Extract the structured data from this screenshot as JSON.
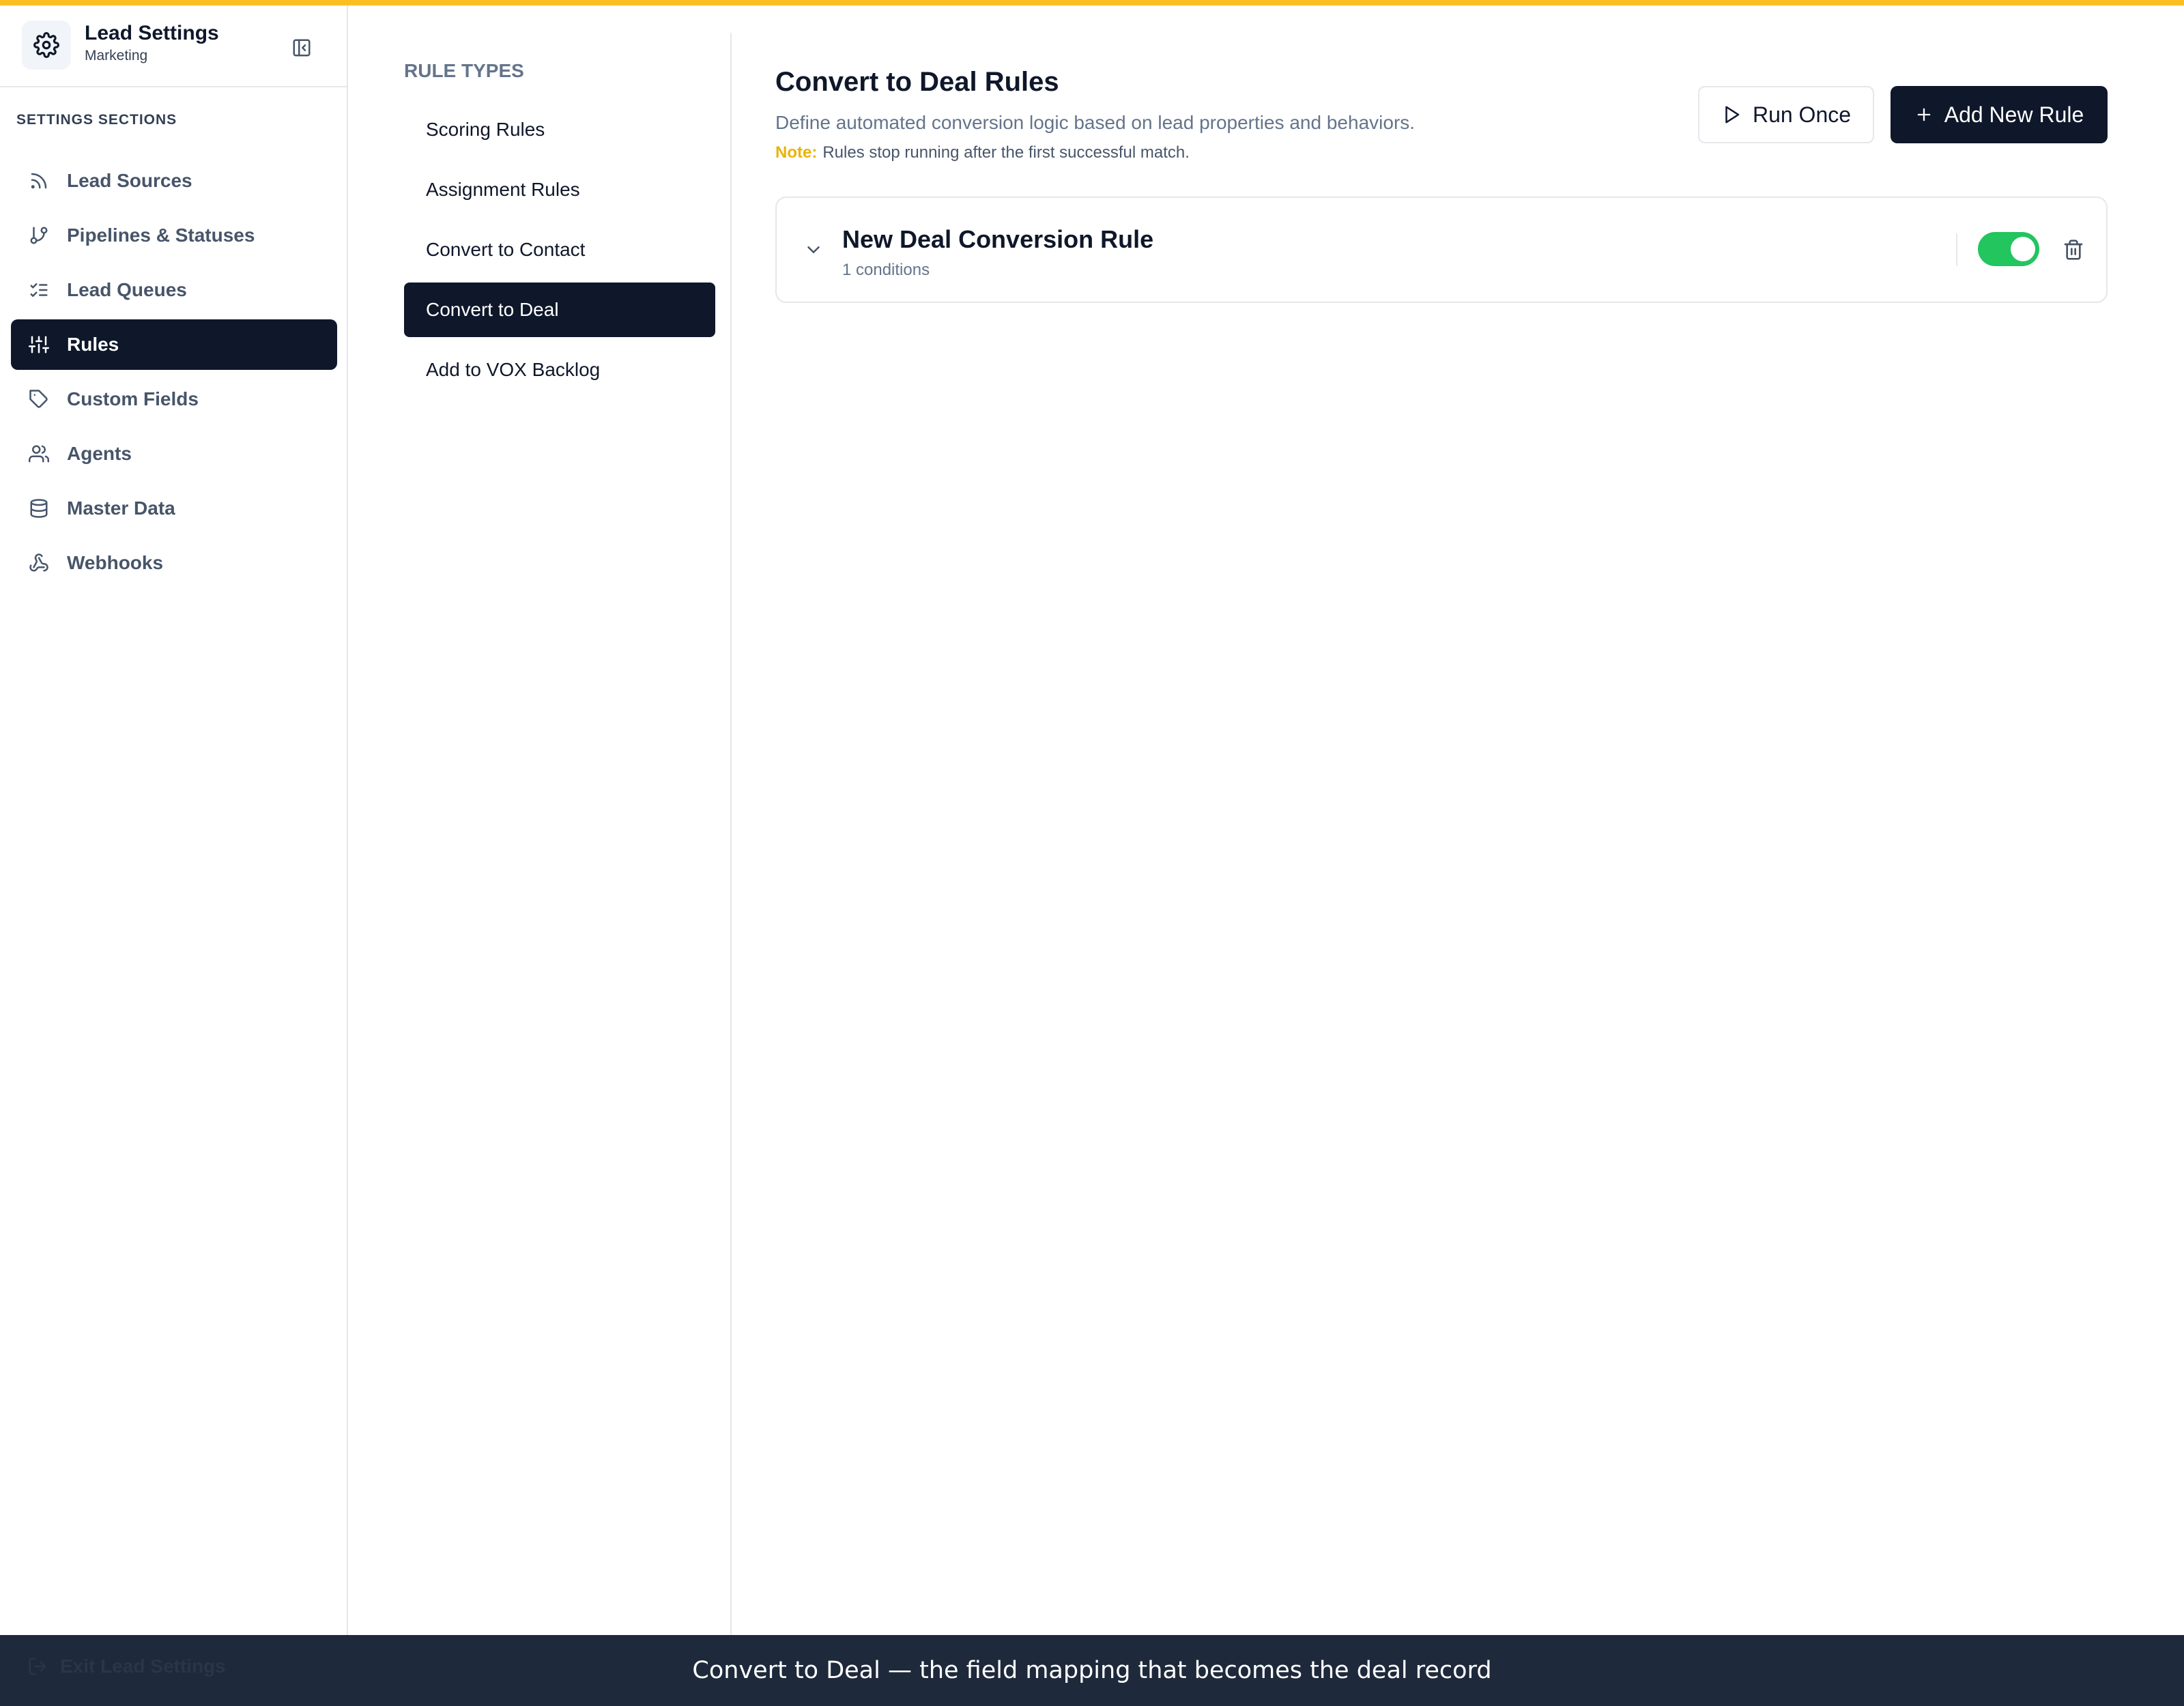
{
  "app": {
    "title": "Lead Settings",
    "subtitle": "Marketing"
  },
  "sidebar": {
    "section_label": "SETTINGS SECTIONS",
    "items": [
      {
        "label": "Lead Sources",
        "icon": "rss-icon"
      },
      {
        "label": "Pipelines & Statuses",
        "icon": "git-branch-icon"
      },
      {
        "label": "Lead Queues",
        "icon": "list-checks-icon"
      },
      {
        "label": "Rules",
        "icon": "sliders-icon",
        "active": true
      },
      {
        "label": "Custom Fields",
        "icon": "tag-icon"
      },
      {
        "label": "Agents",
        "icon": "users-icon"
      },
      {
        "label": "Master Data",
        "icon": "database-icon"
      },
      {
        "label": "Webhooks",
        "icon": "webhook-icon"
      }
    ],
    "exit_label": "Exit Lead Settings"
  },
  "rule_types": {
    "label": "RULE TYPES",
    "items": [
      {
        "label": "Scoring Rules"
      },
      {
        "label": "Assignment Rules"
      },
      {
        "label": "Convert to Contact"
      },
      {
        "label": "Convert to Deal",
        "active": true
      },
      {
        "label": "Add to VOX Backlog"
      }
    ]
  },
  "main": {
    "title": "Convert to Deal Rules",
    "description": "Define automated conversion logic based on lead properties and behaviors.",
    "note_label": "Note:",
    "note_text": "Rules stop running after the first successful match.",
    "run_once_label": "Run Once",
    "add_rule_label": "Add New Rule",
    "rules": [
      {
        "name": "New Deal Conversion Rule",
        "conditions": "1 conditions",
        "enabled": true
      }
    ]
  },
  "caption": "Convert to Deal — the field mapping that becomes the deal record",
  "colors": {
    "accent": "#fbbf24",
    "primary": "#0f172a",
    "toggle_on": "#22c55e",
    "note": "#eab308",
    "caption_bg": "#1e293b"
  }
}
